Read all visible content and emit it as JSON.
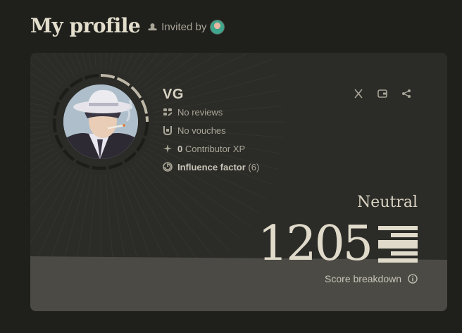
{
  "header": {
    "title": "My profile",
    "invited_label": "Invited by"
  },
  "profile": {
    "username": "VG",
    "reviews": "No reviews",
    "vouches": "No vouches",
    "xp_value": "0",
    "xp_label": "Contributor XP",
    "influence_label": "Influence factor",
    "influence_value": "(6)"
  },
  "score": {
    "level": "Neutral",
    "value": "1205",
    "breakdown_label": "Score breakdown"
  },
  "icons": {
    "invited": "hat-icon",
    "reviews": "reviews-icon",
    "vouches": "vouch-icon",
    "xp": "sparkle-icon",
    "influence": "influence-icon",
    "x": "x-logo-icon",
    "wallet": "wallet-icon",
    "share": "share-icon",
    "score_glyph": "score-level-icon",
    "info": "info-icon"
  },
  "colors": {
    "background": "#1f1f1c",
    "card": "#2b2b27",
    "card_footer": "#4b4a44",
    "text": "#c9c5b9",
    "muted": "#a9a597"
  }
}
